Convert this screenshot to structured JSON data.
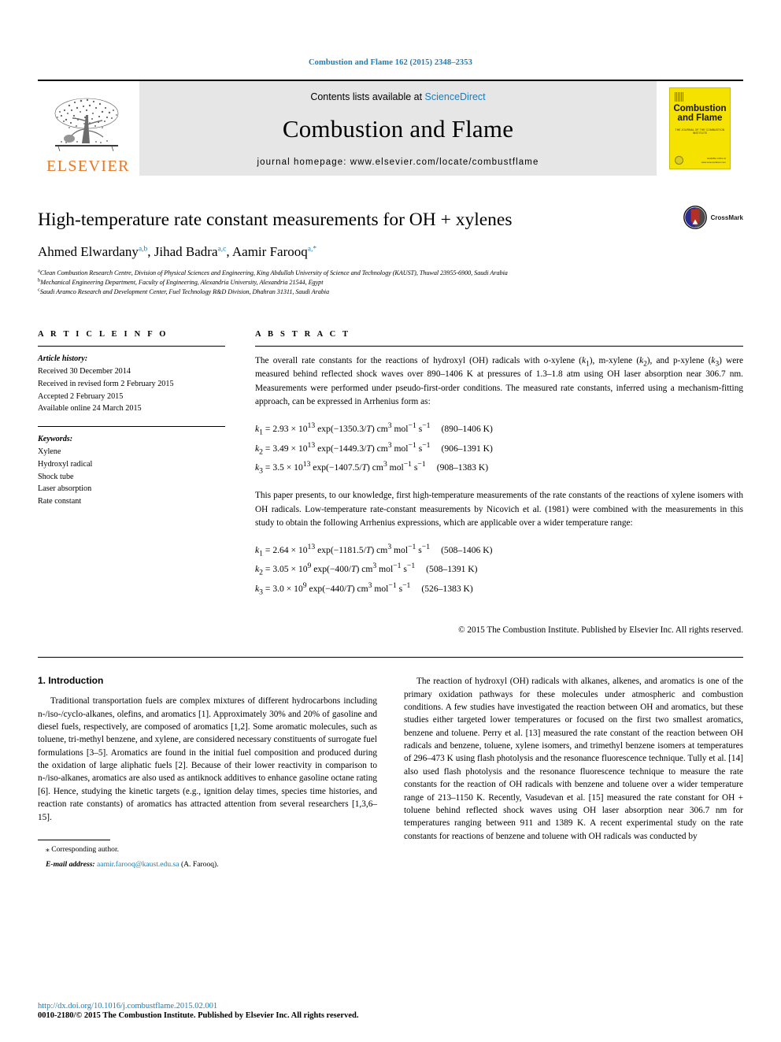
{
  "running_head": "Combustion and Flame 162 (2015) 2348–2353",
  "masthead": {
    "contents_prefix": "Contents lists available at ",
    "sciencedirect": "ScienceDirect",
    "journal_name": "Combustion and Flame",
    "homepage_prefix": "journal homepage: ",
    "homepage_url": "www.elsevier.com/locate/combustflame",
    "publisher_wordmark": "ELSEVIER",
    "cover": {
      "title_line1": "Combustion",
      "title_line2": "and Flame",
      "subtitle": "THE JOURNAL OF THE COMBUSTION INSTITUTE",
      "footer_line1": "available online at",
      "footer_line2": "www.sciencedirect.com"
    },
    "accent_color": "#1b7db8",
    "elsevier_orange": "#E87722",
    "band_color": "#e6e6e6",
    "cover_color": "#F5E200"
  },
  "article": {
    "title": "High-temperature rate constant measurements for OH + xylenes",
    "crossmark_label": "CrossMark",
    "authors": [
      {
        "name": "Ahmed Elwardany",
        "marks": "a,b"
      },
      {
        "name": "Jihad Badra",
        "marks": "a,c"
      },
      {
        "name": "Aamir Farooq",
        "marks": "a,*"
      }
    ],
    "authors_plain": "Ahmed Elwardany a,b, Jihad Badra a,c, Aamir Farooq a,*",
    "affiliations": [
      {
        "mark": "a",
        "text": "Clean Combustion Research Centre, Division of Physical Sciences and Engineering, King Abdullah University of Science and Technology (KAUST), Thuwal 23955-6900, Saudi Arabia"
      },
      {
        "mark": "b",
        "text": "Mechanical Engineering Department, Faculty of Engineering, Alexandria University, Alexandria 21544, Egypt"
      },
      {
        "mark": "c",
        "text": "Saudi Aramco Research and Development Center, Fuel Technology R&D Division, Dhahran 31311, Saudi Arabia"
      }
    ]
  },
  "article_info": {
    "section_label": "A R T I C L E   I N F O",
    "history_label": "Article history:",
    "history": [
      "Received 30 December 2014",
      "Received in revised form 2 February 2015",
      "Accepted 2 February 2015",
      "Available online 24 March 2015"
    ],
    "keywords_label": "Keywords:",
    "keywords": [
      "Xylene",
      "Hydroxyl radical",
      "Shock tube",
      "Laser absorption",
      "Rate constant"
    ]
  },
  "abstract": {
    "section_label": "A B S T R A C T",
    "paragraph1_parts": {
      "p1": "The overall rate constants for the reactions of hydroxyl (OH) radicals with o-xylene (",
      "k1": "k",
      "k1sub": "1",
      "p2": "), m-xylene (",
      "k2": "k",
      "k2sub": "2",
      "p3": "), and p-xylene (",
      "k3": "k",
      "k3sub": "3",
      "p4": ") were measured behind reflected shock waves over 890–1406 K at pressures of 1.3–1.8 atm using OH laser absorption near 306.7 nm. Measurements were performed under pseudo-first-order conditions. The measured rate constants, inferred using a mechanism-fitting approach, can be expressed in Arrhenius form as:"
    },
    "equations_1": [
      {
        "lhs": "k",
        "lhs_sub": "1",
        "pre": " = 2.93 × 10",
        "exp": "13",
        "mid": " exp(−1350.3/",
        "var": "T",
        "post": ") cm",
        "post_exp": "3",
        "units_a": " mol",
        "units_exp": "−1",
        "units_b": " s",
        "units_b_exp": "−1",
        "range": "(890–1406 K)"
      },
      {
        "lhs": "k",
        "lhs_sub": "2",
        "pre": " = 3.49 × 10",
        "exp": "13",
        "mid": " exp(−1449.3/",
        "var": "T",
        "post": ") cm",
        "post_exp": "3",
        "units_a": " mol",
        "units_exp": "−1",
        "units_b": " s",
        "units_b_exp": "−1",
        "range": "(906–1391 K)"
      },
      {
        "lhs": "k",
        "lhs_sub": "3",
        "pre": " = 3.5 × 10",
        "exp": "13",
        "mid": " exp(−1407.5/",
        "var": "T",
        "post": ") cm",
        "post_exp": "3",
        "units_a": " mol",
        "units_exp": "−1",
        "units_b": " s",
        "units_b_exp": "−1",
        "range": "(908–1383 K)"
      }
    ],
    "paragraph2": "This paper presents, to our knowledge, first high-temperature measurements of the rate constants of the reactions of xylene isomers with OH radicals. Low-temperature rate-constant measurements by Nicovich et al. (1981) were combined with the measurements in this study to obtain the following Arrhenius expressions, which are applicable over a wider temperature range:",
    "equations_2": [
      {
        "lhs": "k",
        "lhs_sub": "1",
        "pre": " = 2.64 × 10",
        "exp": "13",
        "mid": " exp(−1181.5/",
        "var": "T",
        "post": ") cm",
        "post_exp": "3",
        "units_a": " mol",
        "units_exp": "−1",
        "units_b": " s",
        "units_b_exp": "−1",
        "range": "(508–1406 K)"
      },
      {
        "lhs": "k",
        "lhs_sub": "2",
        "pre": " = 3.05 × 10",
        "exp": "9",
        "mid": " exp(−400/",
        "var": "T",
        "post": ") cm",
        "post_exp": "3",
        "units_a": " mol",
        "units_exp": "−1",
        "units_b": " s",
        "units_b_exp": "−1",
        "range": "(508–1391 K)"
      },
      {
        "lhs": "k",
        "lhs_sub": "3",
        "pre": " = 3.0 × 10",
        "exp": "9",
        "mid": " exp(−440/",
        "var": "T",
        "post": ") cm",
        "post_exp": "3",
        "units_a": " mol",
        "units_exp": "−1",
        "units_b": " s",
        "units_b_exp": "−1",
        "range": "(526–1383 K)"
      }
    ],
    "copyright": "© 2015 The Combustion Institute. Published by Elsevier Inc. All rights reserved."
  },
  "body": {
    "section_heading": "1. Introduction",
    "left_paragraph": "Traditional transportation fuels are complex mixtures of different hydrocarbons including n-/iso-/cyclo-alkanes, olefins, and aromatics [1]. Approximately 30% and 20% of gasoline and diesel fuels, respectively, are composed of aromatics [1,2]. Some aromatic molecules, such as toluene, tri-methyl benzene, and xylene, are considered necessary constituents of surrogate fuel formulations [3–5]. Aromatics are found in the initial fuel composition and produced during the oxidation of large aliphatic fuels [2]. Because of their lower reactivity in comparison to n-/iso-alkanes, aromatics are also used as antiknock additives to enhance gasoline octane rating [6]. Hence, studying the kinetic targets (e.g., ignition delay times, species time histories, and reaction rate constants) of aromatics has attracted attention from several researchers [1,3,6–15].",
    "right_paragraph": "The reaction of hydroxyl (OH) radicals with alkanes, alkenes, and aromatics is one of the primary oxidation pathways for these molecules under atmospheric and combustion conditions. A few studies have investigated the reaction between OH and aromatics, but these studies either targeted lower temperatures or focused on the first two smallest aromatics, benzene and toluene. Perry et al. [13] measured the rate constant of the reaction between OH radicals and benzene, toluene, xylene isomers, and trimethyl benzene isomers at temperatures of 296–473 K using flash photolysis and the resonance fluorescence technique. Tully et al. [14] also used flash photolysis and the resonance fluorescence technique to measure the rate constants for the reaction of OH radicals with benzene and toluene over a wider temperature range of 213–1150 K. Recently, Vasudevan et al. [15] measured the rate constant for OH + toluene behind reflected shock waves using OH laser absorption near 306.7 nm for temperatures ranging between 911 and 1389 K. A recent experimental study on the rate constants for reactions of benzene and toluene with OH radicals was conducted by"
  },
  "footnote": {
    "corresponding_marker": "⁎",
    "corresponding_text": "Corresponding author.",
    "email_label": "E-mail address:",
    "email": "aamir.farooq@kaust.edu.sa",
    "email_owner": "(A. Farooq)."
  },
  "page_footer": {
    "doi": "http://dx.doi.org/10.1016/j.combustflame.2015.02.001",
    "issn_line": "0010-2180/© 2015 The Combustion Institute. Published by Elsevier Inc. All rights reserved."
  }
}
